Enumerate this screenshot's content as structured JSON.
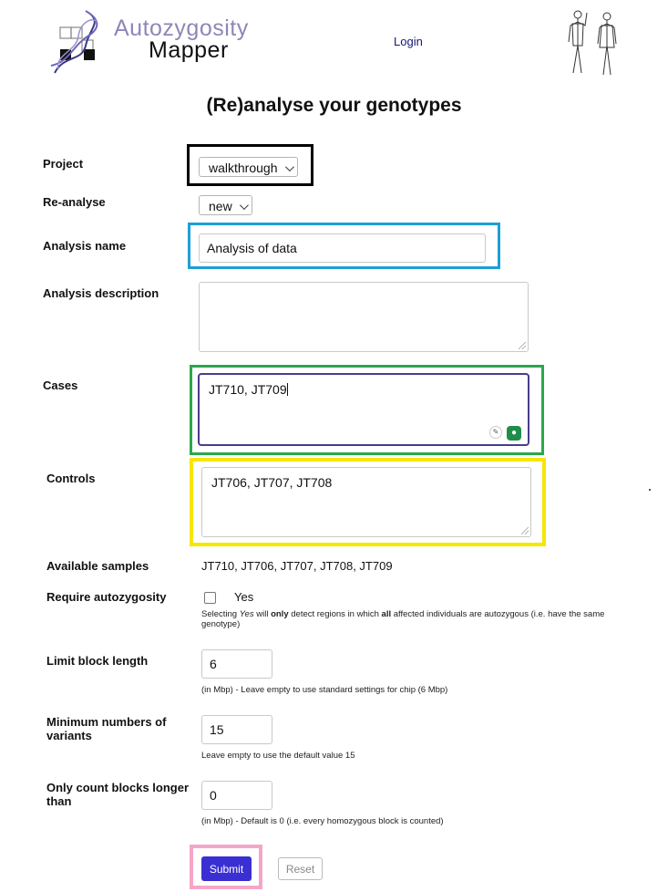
{
  "header": {
    "logo_line1": "Autozygosity",
    "logo_line2": "Mapper",
    "login_label": "Login"
  },
  "page_title": "(Re)analyse your genotypes",
  "form": {
    "project": {
      "label": "Project",
      "value": "walkthrough"
    },
    "reanalyse": {
      "label": "Re-analyse",
      "value": "new"
    },
    "analysis_name": {
      "label": "Analysis name",
      "value": "Analysis of data"
    },
    "analysis_description": {
      "label": "Analysis description",
      "value": ""
    },
    "cases": {
      "label": "Cases",
      "value": "JT710, JT709"
    },
    "controls": {
      "label": "Controls",
      "value": "JT706, JT707, JT708"
    },
    "available_samples": {
      "label": "Available samples",
      "value": "JT710, JT706, JT707, JT708, JT709"
    },
    "require_autozygosity": {
      "label": "Require autozygosity",
      "option": "Yes",
      "checked": false,
      "hint_part1": "Selecting ",
      "hint_yes": "Yes",
      "hint_part2": " will ",
      "hint_only": "only",
      "hint_part3": " detect regions in which ",
      "hint_all": "all",
      "hint_part4": " affected individuals are autozygous (i.e. have the same genotype)"
    },
    "limit_block_length": {
      "label": "Limit block length",
      "value": "6",
      "hint": "(in Mbp) - Leave empty to use standard settings for chip (6 Mbp)"
    },
    "min_variants": {
      "label_line1": "Minimum numbers of",
      "label_line2": "variants",
      "value": "15",
      "hint": "Leave empty to use the default value 15"
    },
    "only_count": {
      "label_line1": "Only count blocks longer",
      "label_line2": "than",
      "value": "0",
      "hint": "(in Mbp) - Default is 0 (i.e. every homozygous block is counted)"
    },
    "submit_label": "Submit",
    "reset_label": "Reset"
  },
  "highlight_colors": {
    "project": "#000000",
    "analysis_name": "#1e9fd6",
    "cases": "#2aa84a",
    "controls": "#f6e600",
    "submit": "#f4a6c8"
  }
}
